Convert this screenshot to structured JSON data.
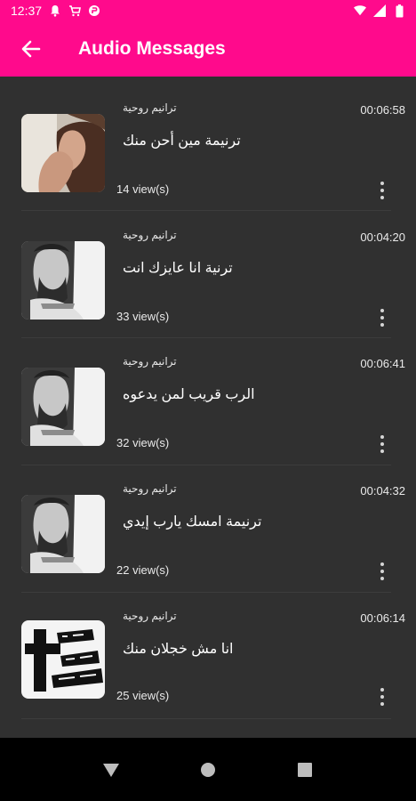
{
  "status_bar": {
    "time": "12:37",
    "icons": [
      "notification-icon",
      "cart-icon",
      "app-icon",
      "wifi-icon",
      "signal-icon",
      "battery-icon"
    ]
  },
  "app_bar": {
    "title": "Audio Messages",
    "back_icon": "arrow-back-icon",
    "color": "#ff0a8c"
  },
  "messages": [
    {
      "category": "ترانيم روحية",
      "duration": "00:06:58",
      "title": "ترنيمة مين أحن منك",
      "views": "14 view(s)",
      "thumb": "praying-hands"
    },
    {
      "category": "ترانيم روحية",
      "duration": "00:04:20",
      "title": "ترنية انا عايزك انت",
      "views": "33 view(s)",
      "thumb": "jesus-portrait"
    },
    {
      "category": "ترانيم روحية",
      "duration": "00:06:41",
      "title": "الرب قريب لمن يدعوه",
      "views": "32 view(s)",
      "thumb": "jesus-portrait"
    },
    {
      "category": "ترانيم روحية",
      "duration": "00:04:32",
      "title": "ترنيمة امسك يارب إيدي",
      "views": "22 view(s)",
      "thumb": "jesus-portrait"
    },
    {
      "category": "ترانيم روحية",
      "duration": "00:06:14",
      "title": "انا مش خجلان منك",
      "views": "25 view(s)",
      "thumb": "cross-text"
    }
  ],
  "nav_bar": {
    "icons": [
      "back-triangle-icon",
      "home-circle-icon",
      "recents-square-icon"
    ]
  }
}
